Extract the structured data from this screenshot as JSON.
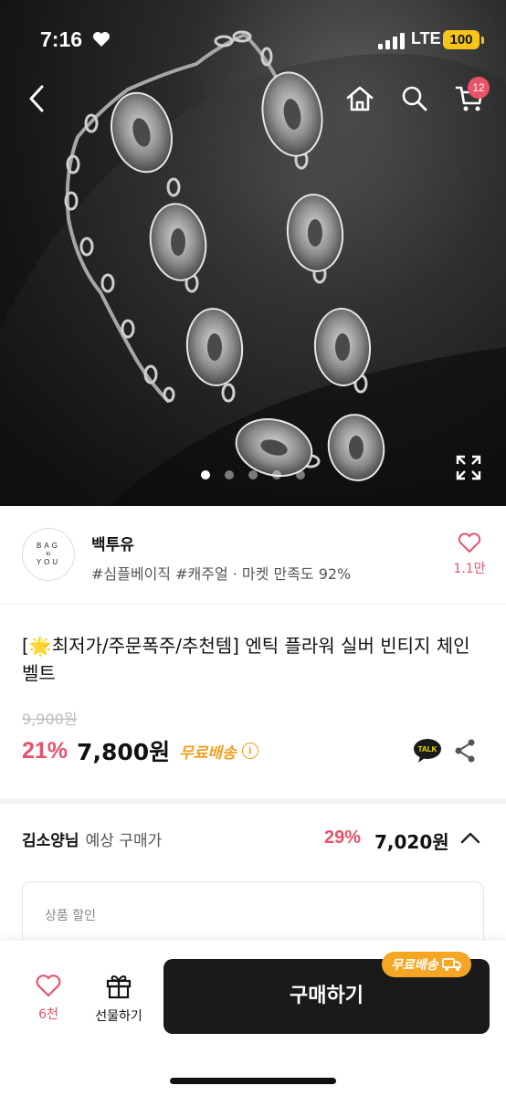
{
  "status_bar": {
    "time": "7:16",
    "network": "LTE",
    "battery": "100"
  },
  "nav": {
    "cart_count": "12",
    "icons": [
      "back-arrow-icon",
      "home-icon",
      "search-icon",
      "cart-icon"
    ]
  },
  "gallery": {
    "total_images": 5,
    "active_index": 0
  },
  "seller": {
    "logo_lines": [
      "BAG",
      "to",
      "YOU"
    ],
    "name": "백투유",
    "tags": "#심플베이직 #캐주얼 · 마켓 만족도 92%",
    "favorite_count": "1.1만"
  },
  "product": {
    "title": "[🌟최저가/주문폭주/추천템] 엔틱 플라워 실버 빈티지 체인 벨트",
    "original_price": "9,900원",
    "discount_rate": "21%",
    "price": "7,800원",
    "shipping": "무료배송",
    "talk_label": "TALK"
  },
  "member_price": {
    "name": "김소양님",
    "label": "예상 구매가",
    "discount_rate": "29%",
    "price": "7,020원"
  },
  "discount_box": {
    "label": "상품 할인"
  },
  "bottom_bar": {
    "like_count": "6천",
    "gift_label": "선물하기",
    "buy_label": "구매하기",
    "shipping_badge": "무료배송"
  },
  "colors": {
    "accent": "#e8536a",
    "shipping": "#f0a020",
    "buy_button": "#1a1a1a"
  }
}
